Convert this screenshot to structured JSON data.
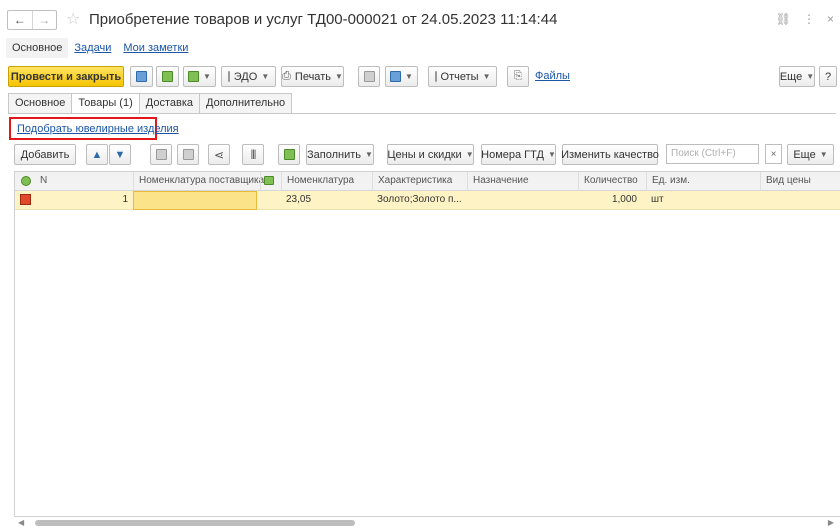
{
  "window": {
    "title": "Приобретение товаров и услуг ТД00-000021 от 24.05.2023 11:14:44"
  },
  "sections": {
    "main": "Основное",
    "tasks": "Задачи",
    "notes": "Мои заметки"
  },
  "toolbar": {
    "post_close": "Провести и закрыть",
    "edo": "ЭДО",
    "print": "Печать",
    "reports": "Отчеты",
    "files": "Файлы",
    "more": "Еще",
    "help": "?"
  },
  "tabs": {
    "items": [
      "Основное",
      "Товары (1)",
      "Доставка",
      "Дополнительно"
    ],
    "active_index": 1
  },
  "pick_link": "Подобрать ювелирные изделия",
  "table_toolbar": {
    "add": "Добавить",
    "fill": "Заполнить",
    "prices": "Цены и скидки",
    "gtd": "Номера ГТД",
    "quality": "Изменить качество",
    "search_placeholder": "Поиск (Ctrl+F)",
    "clear": "×",
    "more": "Еще"
  },
  "table": {
    "columns": {
      "n": "N",
      "supplier_item": "Номенклатура поставщика",
      "item": "Номенклатура",
      "characteristic": "Характеристика",
      "purpose": "Назначение",
      "quantity": "Количество",
      "unit": "Ед. изм.",
      "price_type": "Вид цены"
    },
    "rows": [
      {
        "n": "1",
        "supplier_item": "",
        "item": "23,05",
        "characteristic": "Золото;Золото п...",
        "purpose": "",
        "quantity": "1,000",
        "unit": "шт",
        "price_type": ""
      }
    ]
  },
  "colors": {
    "primary_button": "#f5c300",
    "link": "#1a55a6",
    "highlight_border": "#e3161a",
    "selected_row": "#fdf3c4"
  }
}
